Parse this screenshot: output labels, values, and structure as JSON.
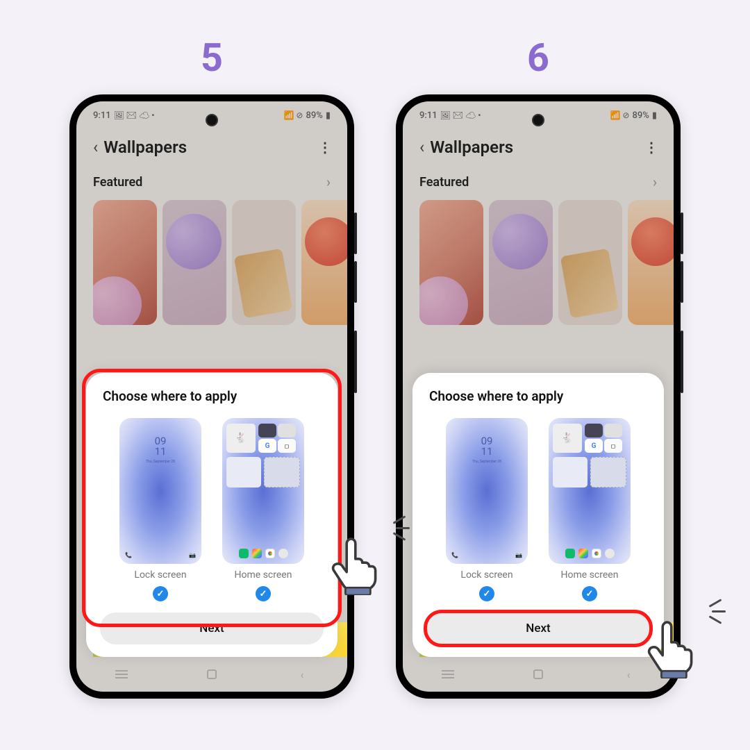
{
  "steps": {
    "left": {
      "number": "5"
    },
    "right": {
      "number": "6"
    }
  },
  "status": {
    "time": "9:11",
    "battery": "89%",
    "icons_left": "🖼 ✉ ☁ •",
    "icons_right": "📶 ⊘"
  },
  "header": {
    "title": "Wallpapers"
  },
  "featured": {
    "label": "Featured"
  },
  "sheet": {
    "title": "Choose where to apply",
    "lock_label": "Lock screen",
    "home_label": "Home screen",
    "lock_clock_top": "09",
    "lock_clock_bottom": "11",
    "lock_date": "Thu, September 28",
    "next": "Next"
  }
}
